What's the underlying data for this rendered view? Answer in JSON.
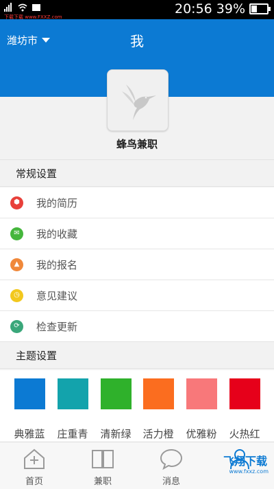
{
  "status": {
    "time": "20:56",
    "battery": "39%",
    "watermark": "下载下载 www.FXXZ.com",
    "battery_level": 0.39
  },
  "header": {
    "city": "潍坊市",
    "title": "我"
  },
  "profile": {
    "app_name": "蜂鸟兼职"
  },
  "general": {
    "title": "常规设置",
    "items": [
      {
        "label": "我的简历",
        "icon": "resume-icon",
        "color": "#e8403a"
      },
      {
        "label": "我的收藏",
        "icon": "favorites-icon",
        "color": "#45b63c"
      },
      {
        "label": "我的报名",
        "icon": "signup-icon",
        "color": "#f0883a"
      },
      {
        "label": "意见建议",
        "icon": "feedback-icon",
        "color": "#f2c81e"
      },
      {
        "label": "检查更新",
        "icon": "update-icon",
        "color": "#3aa77a"
      }
    ]
  },
  "themes": {
    "title": "主题设置",
    "items": [
      {
        "label": "典雅蓝",
        "color": "#0c7ad3"
      },
      {
        "label": "庄重青",
        "color": "#13a3ac"
      },
      {
        "label": "清新绿",
        "color": "#2fb12b"
      },
      {
        "label": "活力橙",
        "color": "#fb6d1f"
      },
      {
        "label": "优雅粉",
        "color": "#f8787a"
      },
      {
        "label": "火热红",
        "color": "#e6001a"
      }
    ]
  },
  "nav": {
    "items": [
      {
        "label": "首页",
        "icon": "home-icon"
      },
      {
        "label": "兼职",
        "icon": "book-icon"
      },
      {
        "label": "消息",
        "icon": "message-icon"
      },
      {
        "label": "",
        "icon": "profile-icon"
      }
    ],
    "watermark": "飞翔下载",
    "watermark_url": "www.fxxz.com"
  }
}
